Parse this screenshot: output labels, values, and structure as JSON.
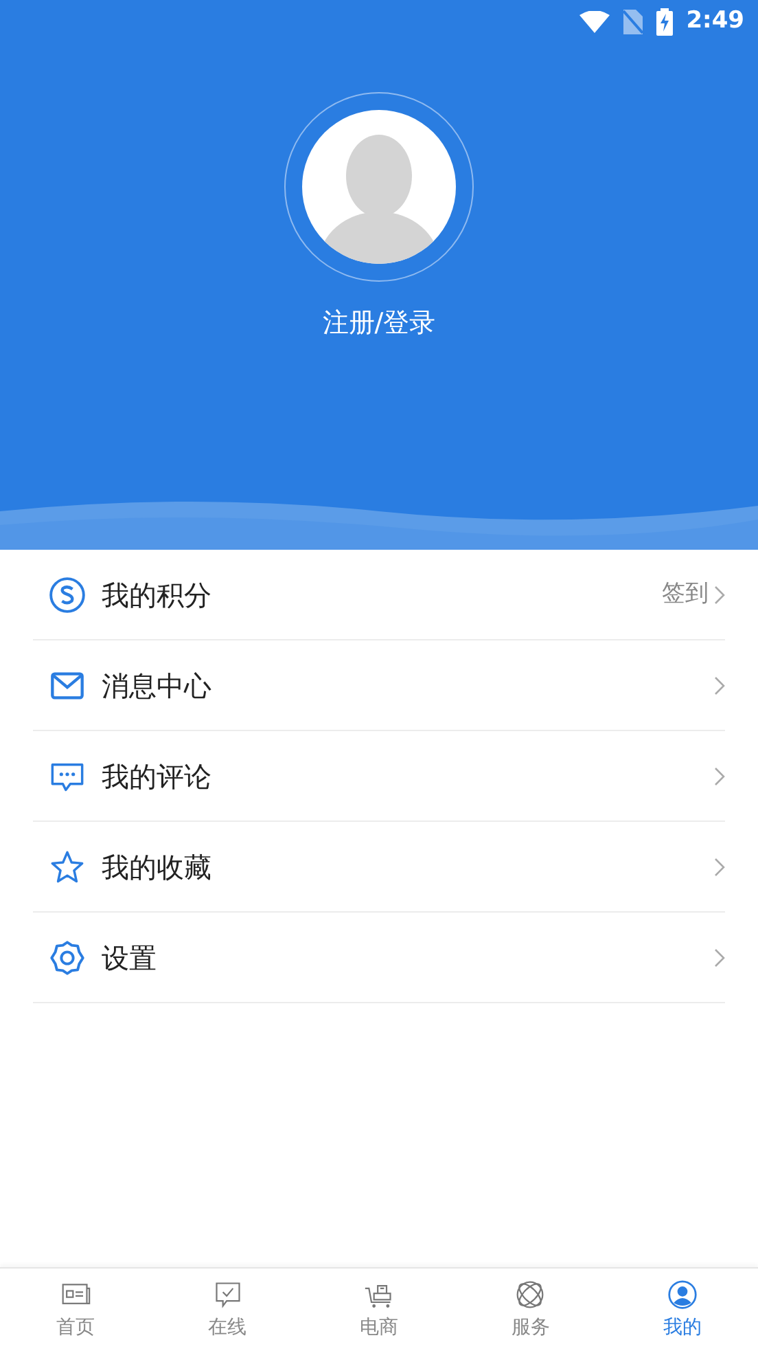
{
  "status_bar": {
    "time": "2:49"
  },
  "profile": {
    "login_label": "注册/登录"
  },
  "menu": [
    {
      "kind": "points",
      "label": "我的积分",
      "action": "签到"
    },
    {
      "kind": "mail",
      "label": "消息中心"
    },
    {
      "kind": "comment",
      "label": "我的评论"
    },
    {
      "kind": "star",
      "label": "我的收藏"
    },
    {
      "kind": "gear",
      "label": "设置"
    }
  ],
  "tabs": [
    {
      "kind": "news",
      "label": "首页",
      "selected": false
    },
    {
      "kind": "online",
      "label": "在线",
      "selected": false
    },
    {
      "kind": "shop",
      "label": "电商",
      "selected": false
    },
    {
      "kind": "service",
      "label": "服务",
      "selected": false
    },
    {
      "kind": "mine",
      "label": "我的",
      "selected": true
    }
  ]
}
